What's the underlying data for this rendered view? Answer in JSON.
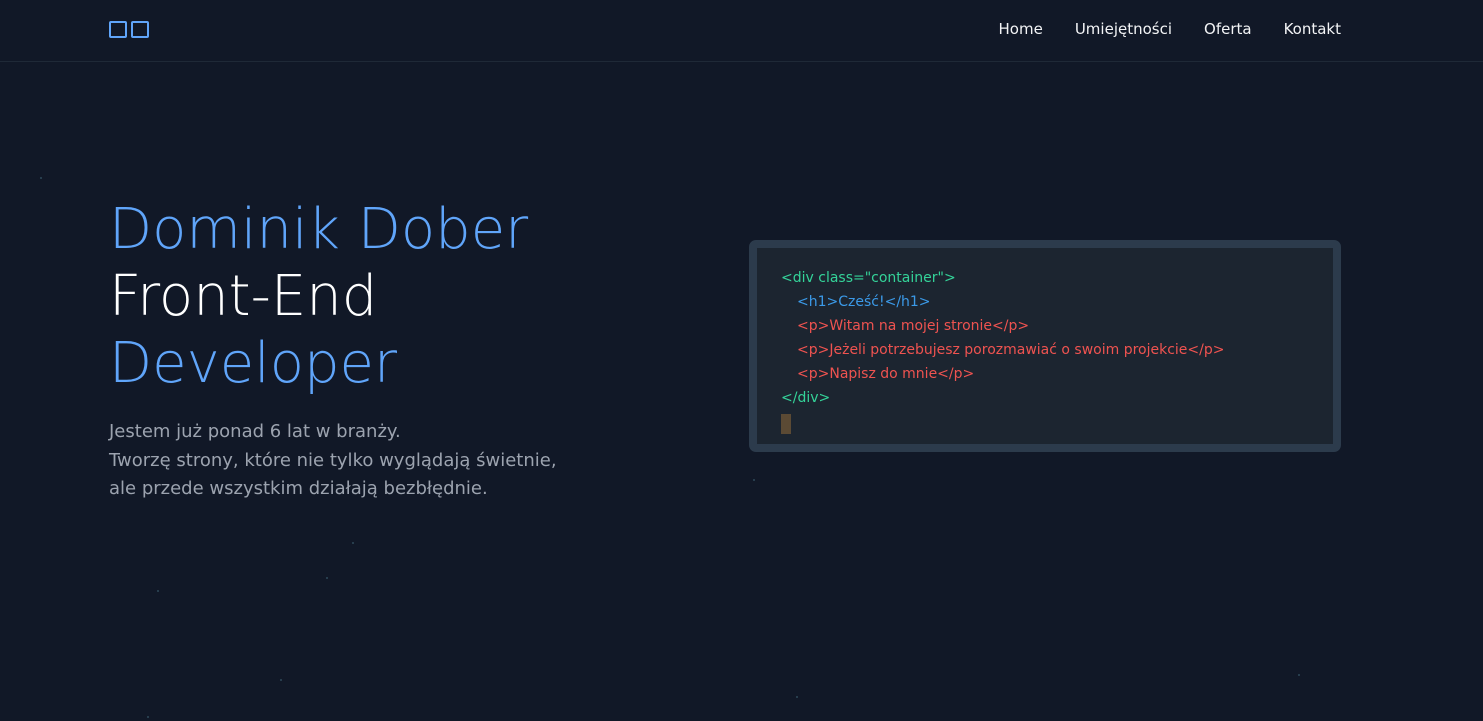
{
  "header": {
    "nav": [
      {
        "label": "Home"
      },
      {
        "label": "Umiejętności"
      },
      {
        "label": "Oferta"
      },
      {
        "label": "Kontakt"
      }
    ]
  },
  "hero": {
    "name": "Dominik Dober",
    "role_line1": "Front-End",
    "role_line2": "Developer",
    "description": [
      "Jestem już ponad 6 lat w branży.",
      "Tworzę strony, które nie tylko wyglądają świetnie,",
      "ale przede wszystkim działają bezbłędnie."
    ]
  },
  "code": {
    "lines": [
      "<div class=\"container\">",
      "<h1>Cześć!</h1>",
      "<p>Witam na mojej stronie</p>",
      "<p>Jeżeli potrzebujesz porozmawiać o swoim projekcie</p>",
      "<p>Napisz do mnie</p>",
      "</div>"
    ]
  },
  "colors": {
    "background": "#111827",
    "accent": "#60a5fa",
    "code_tag": "#34d399",
    "code_heading": "#3b9ae8",
    "code_paragraph": "#ef5350"
  }
}
